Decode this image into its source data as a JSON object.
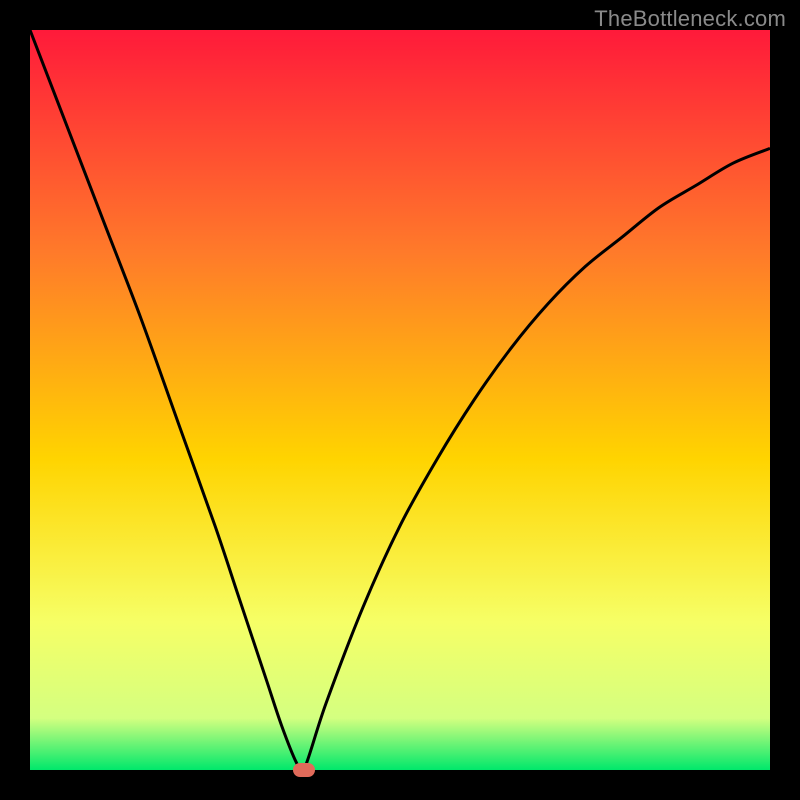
{
  "watermark": "TheBottleneck.com",
  "colors": {
    "frame_bg": "#000000",
    "gradient_top": "#ff1a3a",
    "gradient_mid_upper": "#ff7a2a",
    "gradient_mid": "#ffd400",
    "gradient_mid_lower": "#f6ff66",
    "gradient_lower": "#d4ff80",
    "gradient_bottom": "#00e86b",
    "curve": "#000000",
    "marker": "#e06a5a"
  },
  "chart_data": {
    "type": "line",
    "title": "",
    "xlabel": "",
    "ylabel": "",
    "xlim": [
      0,
      100
    ],
    "ylim": [
      0,
      100
    ],
    "grid": false,
    "legend": false,
    "annotations": [],
    "series": [
      {
        "name": "bottleneck-curve",
        "x": [
          0,
          5,
          10,
          15,
          20,
          25,
          28,
          30,
          32,
          34,
          36,
          37,
          40,
          45,
          50,
          55,
          60,
          65,
          70,
          75,
          80,
          85,
          90,
          95,
          100
        ],
        "y": [
          100,
          87,
          74,
          61,
          47,
          33,
          24,
          18,
          12,
          6,
          1,
          0,
          9,
          22,
          33,
          42,
          50,
          57,
          63,
          68,
          72,
          76,
          79,
          82,
          84
        ]
      }
    ],
    "marker": {
      "x": 37,
      "y": 0
    },
    "background_gradient_stops": [
      {
        "offset": 0.0,
        "color": "#ff1a3a"
      },
      {
        "offset": 0.3,
        "color": "#ff7a2a"
      },
      {
        "offset": 0.58,
        "color": "#ffd400"
      },
      {
        "offset": 0.8,
        "color": "#f6ff66"
      },
      {
        "offset": 0.93,
        "color": "#d4ff80"
      },
      {
        "offset": 1.0,
        "color": "#00e86b"
      }
    ]
  }
}
